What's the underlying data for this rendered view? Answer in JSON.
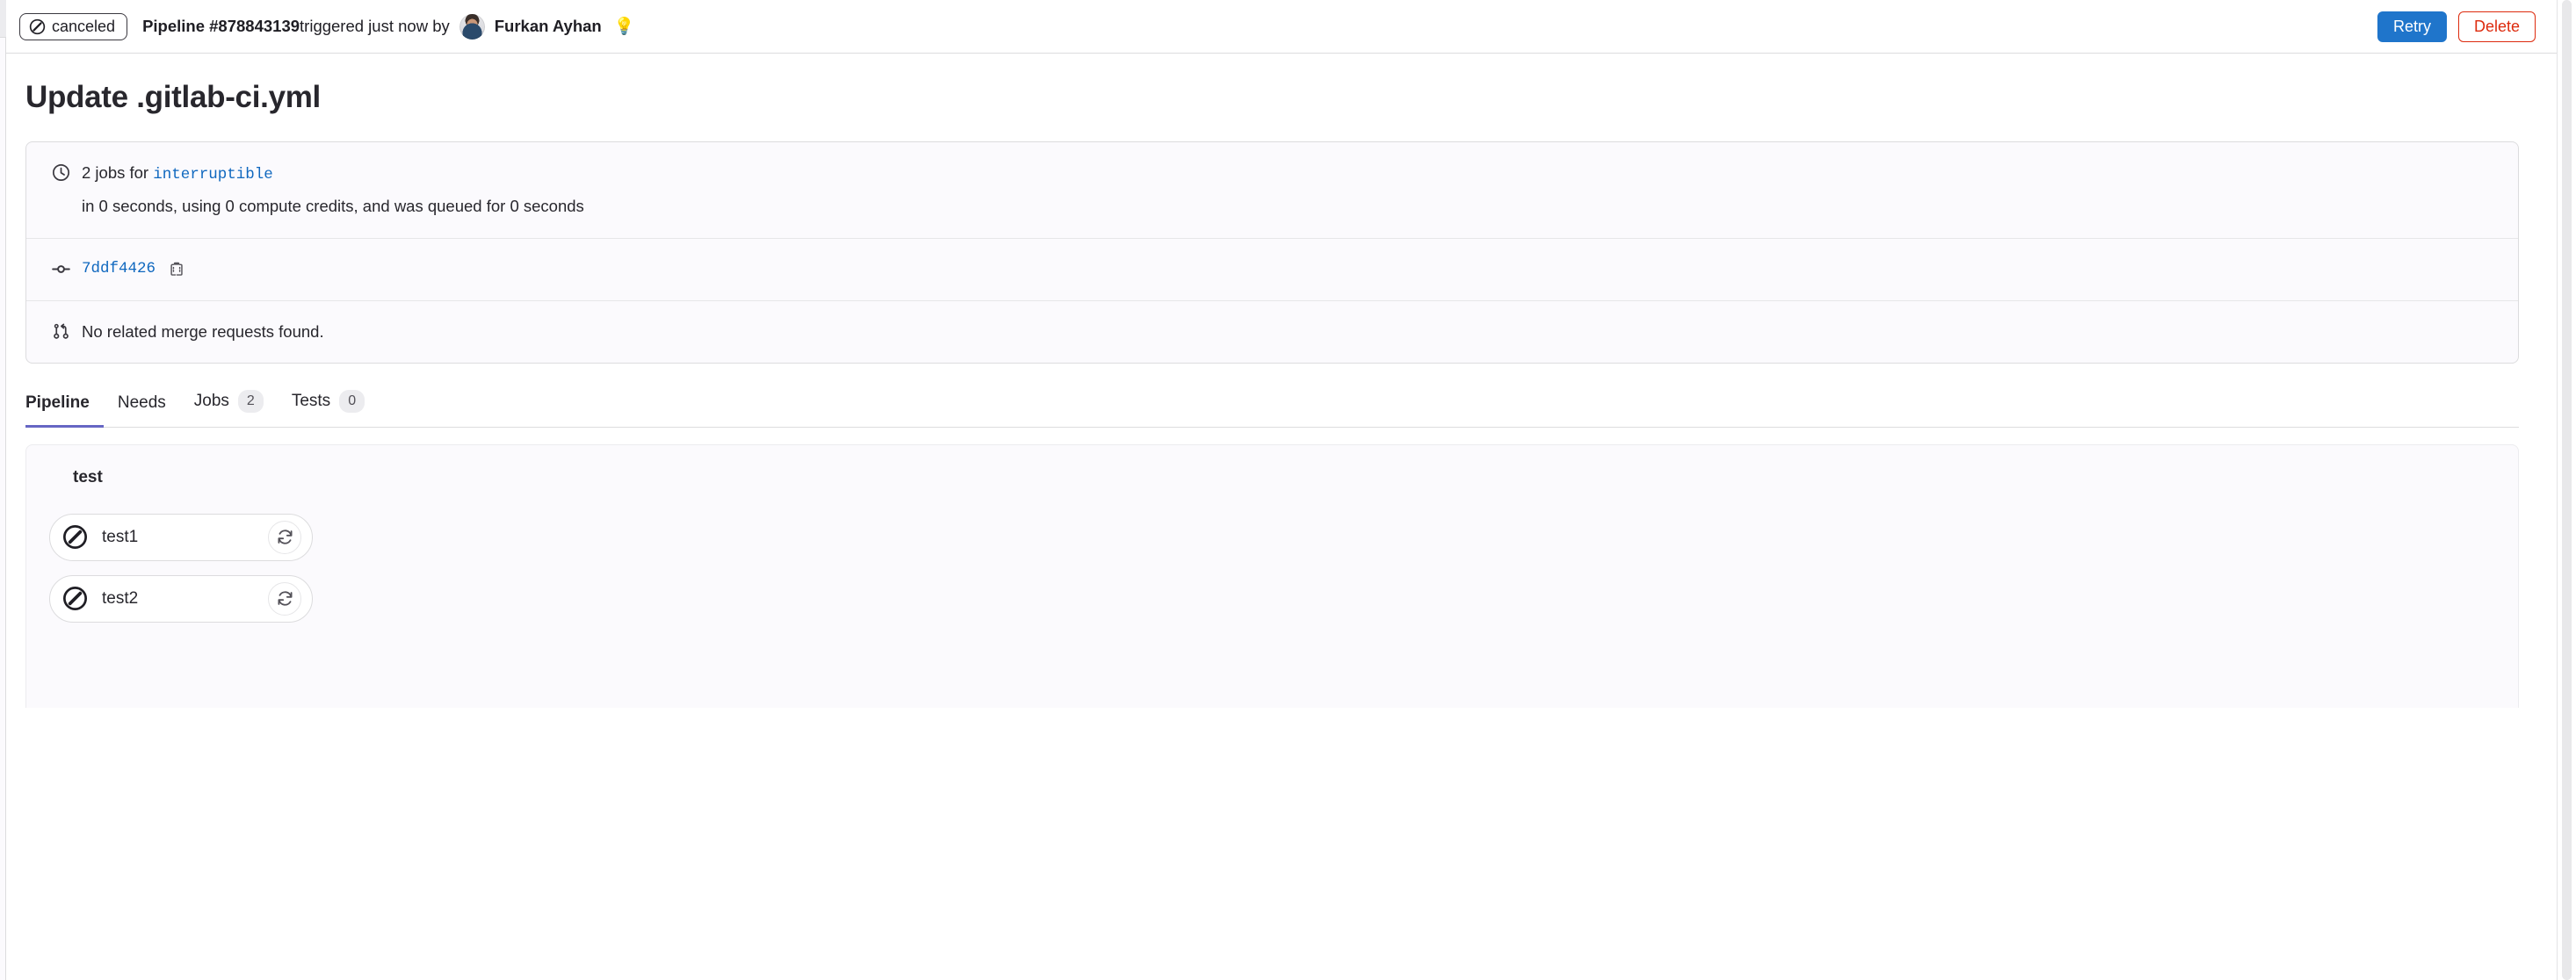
{
  "topbar": {
    "status_label": "canceled",
    "status_icon": "cancel-icon",
    "pipeline_label": "Pipeline #878843139",
    "triggered_text": " triggered just now by ",
    "user_name": "Furkan Ayhan",
    "bulb_icon": "💡",
    "retry_label": "Retry",
    "delete_label": "Delete",
    "accent_primary": "#1f75cb",
    "accent_danger": "#dd2b0e"
  },
  "page": {
    "title": "Update .gitlab-ci.yml"
  },
  "info": {
    "jobs_line_prefix": "2 jobs for ",
    "ref_name": "interruptible",
    "duration_line": "in 0 seconds, using 0 compute credits, and was queued for 0 seconds",
    "commit_sha": "7ddf4426",
    "merge_requests_text": "No related merge requests found.",
    "clock_icon": "clock-icon",
    "commit_icon": "commit-icon",
    "merge_request_icon": "merge-request-icon",
    "copy_icon": "copy-to-clipboard-icon"
  },
  "tabs": [
    {
      "label": "Pipeline",
      "count": null,
      "active": true
    },
    {
      "label": "Needs",
      "count": null,
      "active": false
    },
    {
      "label": "Jobs",
      "count": "2",
      "active": false
    },
    {
      "label": "Tests",
      "count": "0",
      "active": false
    }
  ],
  "graph": {
    "stage_name": "test",
    "jobs": [
      {
        "name": "test1",
        "status_icon": "canceled-icon",
        "action_icon": "retry-icon"
      },
      {
        "name": "test2",
        "status_icon": "canceled-icon",
        "action_icon": "retry-icon"
      }
    ]
  }
}
